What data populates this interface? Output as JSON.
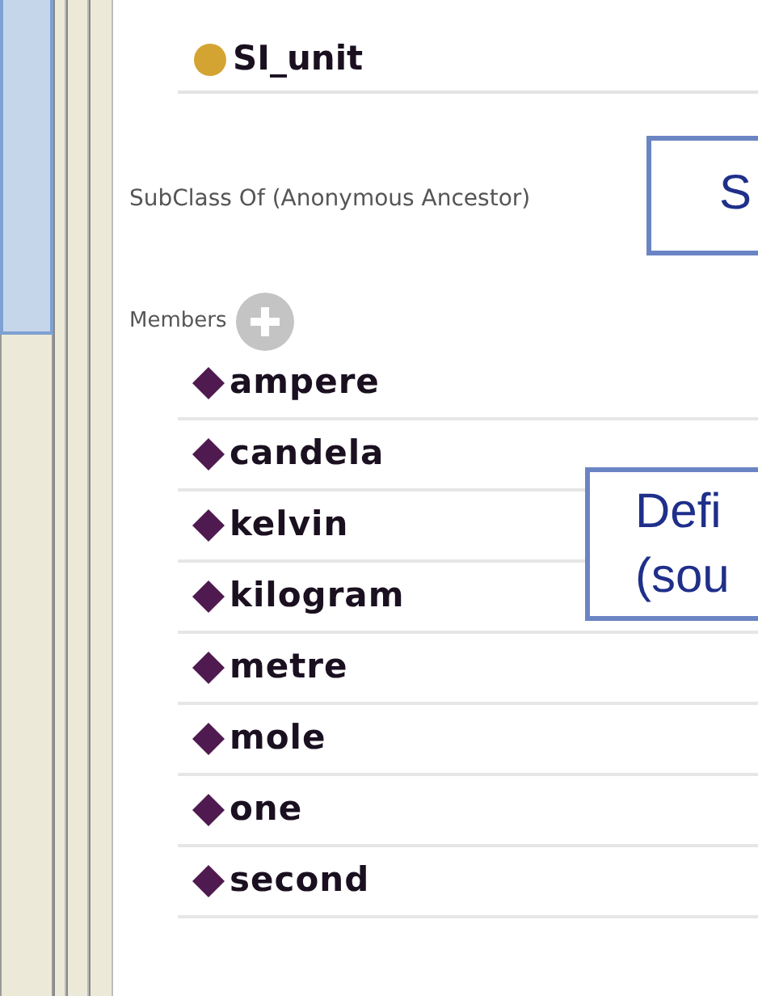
{
  "superclasses": [
    {
      "name": "SI_unit",
      "color": "#d4a432"
    }
  ],
  "anonymous_ancestor_label": "SubClass Of (Anonymous Ancestor)",
  "members_label": "Members",
  "members": [
    "ampere",
    "candela",
    "kelvin",
    "kilogram",
    "metre",
    "mole",
    "one",
    "second"
  ],
  "callouts": [
    {
      "text": "S"
    },
    {
      "text": "Defi\n(sou"
    }
  ]
}
